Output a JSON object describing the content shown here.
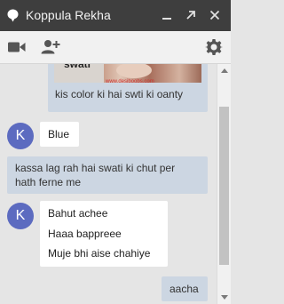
{
  "window": {
    "title": "Koppula Rekha"
  },
  "image_message": {
    "overlay_text": "swati",
    "watermark": "www.desiboobs.com",
    "caption": "kis color ki hai swti ki oanty"
  },
  "messages": [
    {
      "from": "contact",
      "avatar_letter": "K",
      "lines": [
        "Blue"
      ]
    },
    {
      "from": "me",
      "lines": [
        "kassa lag rah hai swati ki chut per",
        "hath ferne me"
      ]
    },
    {
      "from": "contact",
      "avatar_letter": "K",
      "lines": [
        "Bahut achee",
        "Haaa bappreee",
        "Muje bhi aise chahiye"
      ]
    },
    {
      "from": "me",
      "lines": [
        "aacha"
      ]
    }
  ],
  "colors": {
    "header_bg": "#3e3e3e",
    "avatar_bg": "#5c6bc0",
    "outgoing_bubble": "#ccd6e2",
    "incoming_bubble": "#ffffff"
  },
  "icons": [
    "chat-bubble-icon",
    "minimize-icon",
    "popout-icon",
    "close-icon",
    "video-icon",
    "add-person-icon",
    "gear-icon"
  ]
}
